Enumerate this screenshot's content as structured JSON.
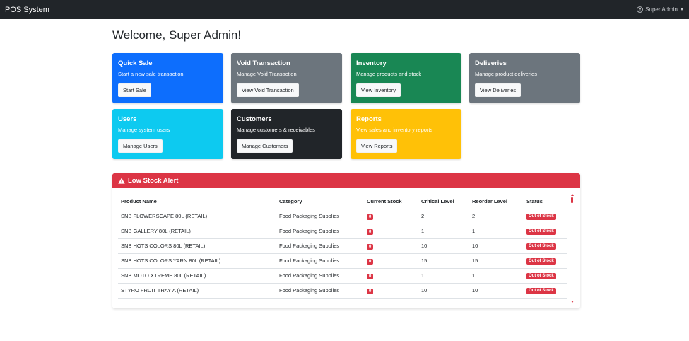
{
  "navbar": {
    "brand": "POS System",
    "user": "Super Admin",
    "user_icon": "user-circle-icon"
  },
  "welcome": "Welcome, Super Admin!",
  "cards": [
    {
      "title": "Quick Sale",
      "desc": "Start a new sale transaction",
      "button": "Start Sale",
      "color": "#0d6efd",
      "text_color": "#ffffff"
    },
    {
      "title": "Void Transaction",
      "desc": "Manage Void Transaction",
      "button": "View Void Transaction",
      "color": "#6c757d",
      "text_color": "#ffffff"
    },
    {
      "title": "Inventory",
      "desc": "Manage products and stock",
      "button": "View Inventory",
      "color": "#198754",
      "text_color": "#ffffff"
    },
    {
      "title": "Deliveries",
      "desc": "Manage product deliveries",
      "button": "View Deliveries",
      "color": "#6c757d",
      "text_color": "#ffffff"
    },
    {
      "title": "Users",
      "desc": "Manage system users",
      "button": "Manage Users",
      "color": "#0dcaf0",
      "text_color": "#ffffff"
    },
    {
      "title": "Customers",
      "desc": "Manage customers & receivables",
      "button": "Manage Customers",
      "color": "#212529",
      "text_color": "#ffffff"
    },
    {
      "title": "Reports",
      "desc": "View sales and inventory reports",
      "button": "View Reports",
      "color": "#ffc107",
      "text_color": "#ffffff"
    }
  ],
  "low_stock": {
    "title": "Low Stock Alert",
    "icon": "warning-triangle-icon",
    "columns": [
      "Product Name",
      "Category",
      "Current Stock",
      "Critical Level",
      "Reorder Level",
      "Status"
    ],
    "rows": [
      {
        "name": "SNB FLOWERSCAPE 80L (RETAIL)",
        "category": "Food Packaging Supplies",
        "stock": "0",
        "critical": "2",
        "reorder": "2",
        "status": "Out of Stock"
      },
      {
        "name": "SNB GALLERY 80L (RETAIL)",
        "category": "Food Packaging Supplies",
        "stock": "0",
        "critical": "1",
        "reorder": "1",
        "status": "Out of Stock"
      },
      {
        "name": "SNB HOTS COLORS 80L (RETAIL)",
        "category": "Food Packaging Supplies",
        "stock": "0",
        "critical": "10",
        "reorder": "10",
        "status": "Out of Stock"
      },
      {
        "name": "SNB HOTS COLORS YARN 80L (RETAIL)",
        "category": "Food Packaging Supplies",
        "stock": "0",
        "critical": "15",
        "reorder": "15",
        "status": "Out of Stock"
      },
      {
        "name": "SNB MOTO XTREME 80L (RETAIL)",
        "category": "Food Packaging Supplies",
        "stock": "0",
        "critical": "1",
        "reorder": "1",
        "status": "Out of Stock"
      },
      {
        "name": "STYRO FRUIT TRAY A (RETAIL)",
        "category": "Food Packaging Supplies",
        "stock": "0",
        "critical": "10",
        "reorder": "10",
        "status": "Out of Stock"
      }
    ]
  }
}
